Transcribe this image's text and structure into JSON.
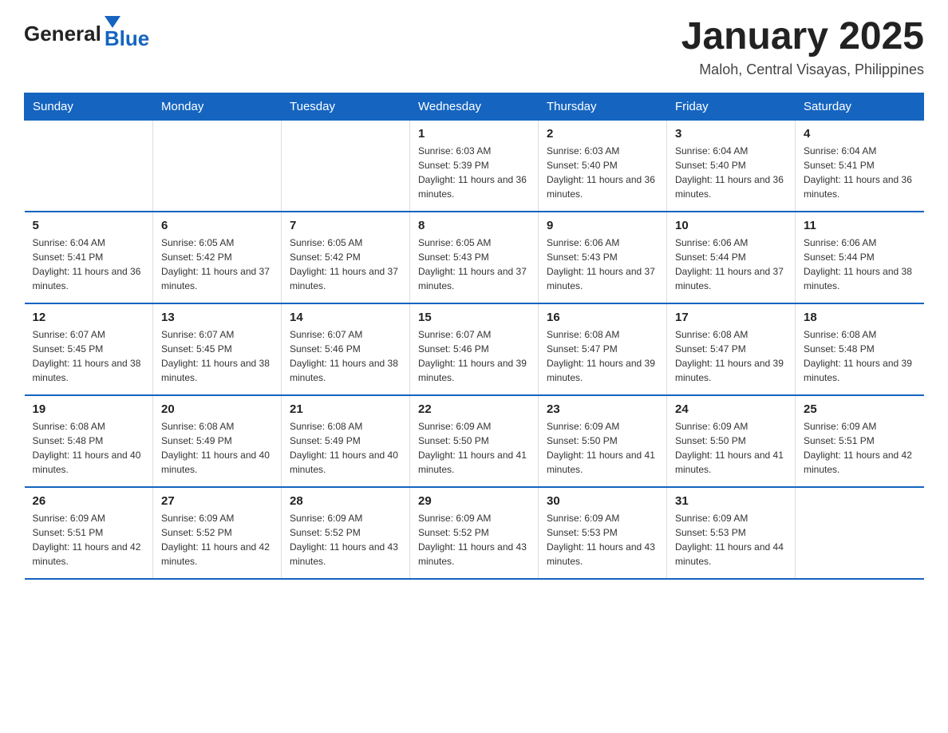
{
  "header": {
    "logo_general": "General",
    "logo_blue": "Blue",
    "title": "January 2025",
    "subtitle": "Maloh, Central Visayas, Philippines"
  },
  "days_of_week": [
    "Sunday",
    "Monday",
    "Tuesday",
    "Wednesday",
    "Thursday",
    "Friday",
    "Saturday"
  ],
  "weeks": [
    [
      {
        "day": "",
        "info": ""
      },
      {
        "day": "",
        "info": ""
      },
      {
        "day": "",
        "info": ""
      },
      {
        "day": "1",
        "info": "Sunrise: 6:03 AM\nSunset: 5:39 PM\nDaylight: 11 hours and 36 minutes."
      },
      {
        "day": "2",
        "info": "Sunrise: 6:03 AM\nSunset: 5:40 PM\nDaylight: 11 hours and 36 minutes."
      },
      {
        "day": "3",
        "info": "Sunrise: 6:04 AM\nSunset: 5:40 PM\nDaylight: 11 hours and 36 minutes."
      },
      {
        "day": "4",
        "info": "Sunrise: 6:04 AM\nSunset: 5:41 PM\nDaylight: 11 hours and 36 minutes."
      }
    ],
    [
      {
        "day": "5",
        "info": "Sunrise: 6:04 AM\nSunset: 5:41 PM\nDaylight: 11 hours and 36 minutes."
      },
      {
        "day": "6",
        "info": "Sunrise: 6:05 AM\nSunset: 5:42 PM\nDaylight: 11 hours and 37 minutes."
      },
      {
        "day": "7",
        "info": "Sunrise: 6:05 AM\nSunset: 5:42 PM\nDaylight: 11 hours and 37 minutes."
      },
      {
        "day": "8",
        "info": "Sunrise: 6:05 AM\nSunset: 5:43 PM\nDaylight: 11 hours and 37 minutes."
      },
      {
        "day": "9",
        "info": "Sunrise: 6:06 AM\nSunset: 5:43 PM\nDaylight: 11 hours and 37 minutes."
      },
      {
        "day": "10",
        "info": "Sunrise: 6:06 AM\nSunset: 5:44 PM\nDaylight: 11 hours and 37 minutes."
      },
      {
        "day": "11",
        "info": "Sunrise: 6:06 AM\nSunset: 5:44 PM\nDaylight: 11 hours and 38 minutes."
      }
    ],
    [
      {
        "day": "12",
        "info": "Sunrise: 6:07 AM\nSunset: 5:45 PM\nDaylight: 11 hours and 38 minutes."
      },
      {
        "day": "13",
        "info": "Sunrise: 6:07 AM\nSunset: 5:45 PM\nDaylight: 11 hours and 38 minutes."
      },
      {
        "day": "14",
        "info": "Sunrise: 6:07 AM\nSunset: 5:46 PM\nDaylight: 11 hours and 38 minutes."
      },
      {
        "day": "15",
        "info": "Sunrise: 6:07 AM\nSunset: 5:46 PM\nDaylight: 11 hours and 39 minutes."
      },
      {
        "day": "16",
        "info": "Sunrise: 6:08 AM\nSunset: 5:47 PM\nDaylight: 11 hours and 39 minutes."
      },
      {
        "day": "17",
        "info": "Sunrise: 6:08 AM\nSunset: 5:47 PM\nDaylight: 11 hours and 39 minutes."
      },
      {
        "day": "18",
        "info": "Sunrise: 6:08 AM\nSunset: 5:48 PM\nDaylight: 11 hours and 39 minutes."
      }
    ],
    [
      {
        "day": "19",
        "info": "Sunrise: 6:08 AM\nSunset: 5:48 PM\nDaylight: 11 hours and 40 minutes."
      },
      {
        "day": "20",
        "info": "Sunrise: 6:08 AM\nSunset: 5:49 PM\nDaylight: 11 hours and 40 minutes."
      },
      {
        "day": "21",
        "info": "Sunrise: 6:08 AM\nSunset: 5:49 PM\nDaylight: 11 hours and 40 minutes."
      },
      {
        "day": "22",
        "info": "Sunrise: 6:09 AM\nSunset: 5:50 PM\nDaylight: 11 hours and 41 minutes."
      },
      {
        "day": "23",
        "info": "Sunrise: 6:09 AM\nSunset: 5:50 PM\nDaylight: 11 hours and 41 minutes."
      },
      {
        "day": "24",
        "info": "Sunrise: 6:09 AM\nSunset: 5:50 PM\nDaylight: 11 hours and 41 minutes."
      },
      {
        "day": "25",
        "info": "Sunrise: 6:09 AM\nSunset: 5:51 PM\nDaylight: 11 hours and 42 minutes."
      }
    ],
    [
      {
        "day": "26",
        "info": "Sunrise: 6:09 AM\nSunset: 5:51 PM\nDaylight: 11 hours and 42 minutes."
      },
      {
        "day": "27",
        "info": "Sunrise: 6:09 AM\nSunset: 5:52 PM\nDaylight: 11 hours and 42 minutes."
      },
      {
        "day": "28",
        "info": "Sunrise: 6:09 AM\nSunset: 5:52 PM\nDaylight: 11 hours and 43 minutes."
      },
      {
        "day": "29",
        "info": "Sunrise: 6:09 AM\nSunset: 5:52 PM\nDaylight: 11 hours and 43 minutes."
      },
      {
        "day": "30",
        "info": "Sunrise: 6:09 AM\nSunset: 5:53 PM\nDaylight: 11 hours and 43 minutes."
      },
      {
        "day": "31",
        "info": "Sunrise: 6:09 AM\nSunset: 5:53 PM\nDaylight: 11 hours and 44 minutes."
      },
      {
        "day": "",
        "info": ""
      }
    ]
  ]
}
